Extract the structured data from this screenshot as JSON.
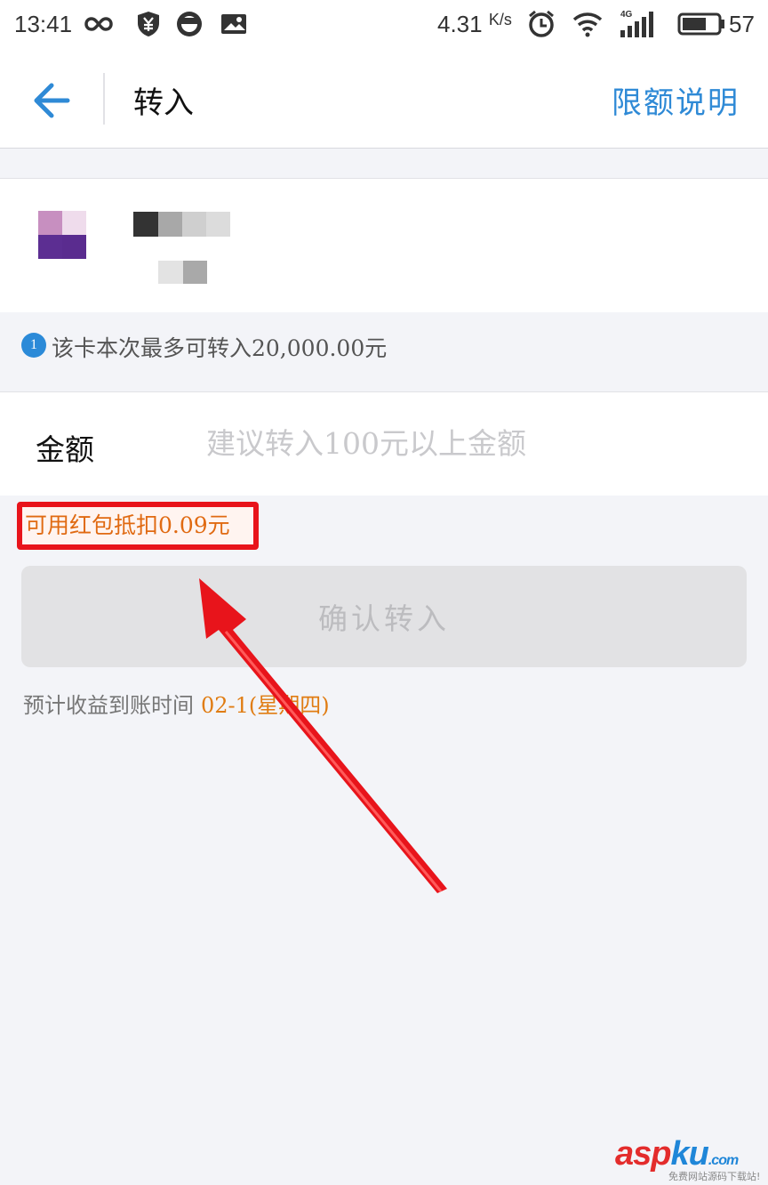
{
  "status_bar": {
    "time": "13:41",
    "net_speed": "4.31",
    "net_speed_unit": "K/s",
    "network_type": "4G",
    "battery_percent": "57",
    "icons": [
      "infinity-icon",
      "shield-yen-icon",
      "face-icon",
      "image-icon",
      "alarm-icon",
      "wifi-icon",
      "signal-icon",
      "battery-icon"
    ]
  },
  "nav": {
    "back_icon": "back-arrow-icon",
    "title": "转入",
    "right_action": "限额说明",
    "accent_color": "#2f8ad6"
  },
  "card": {
    "logo_icon": "bank-logo-pixelated",
    "name_obscured": true
  },
  "notice": {
    "icon_text": "1",
    "text": "该卡本次最多可转入20,000.00元"
  },
  "amount": {
    "label": "金额",
    "placeholder": "建议转入100元以上金额",
    "value": ""
  },
  "red_packet": {
    "text": "可用红包抵扣0.09元",
    "text_color": "#e06a12",
    "highlight_color": "#e8141b"
  },
  "confirm": {
    "label": "确认转入",
    "enabled": false
  },
  "arrival": {
    "label": "预计收益到账时间",
    "date": "02-1",
    "weekday": "(星期四)",
    "date_color": "#e07c12"
  },
  "watermark": {
    "brand_a": "asp",
    "brand_b": "ku",
    "suffix": ".com",
    "tagline": "免费网站源码下载站!"
  }
}
